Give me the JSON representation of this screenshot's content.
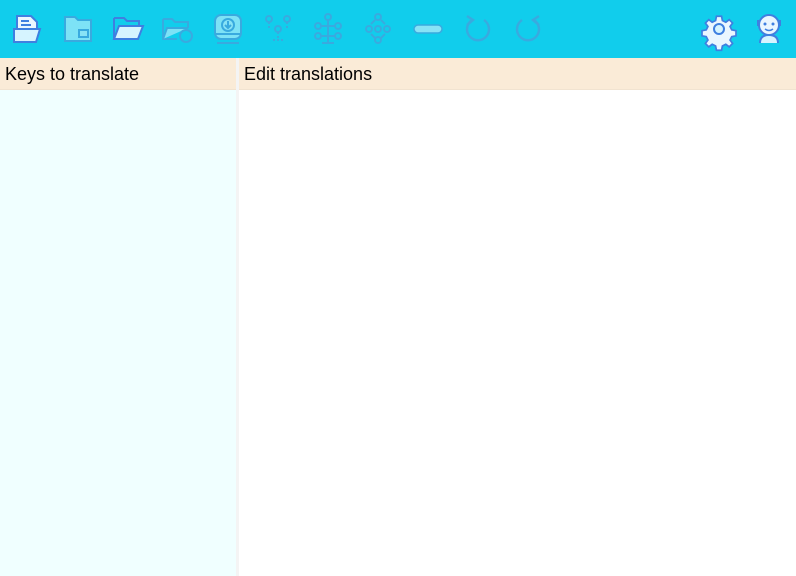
{
  "toolbar": {
    "background": "#11cdec",
    "icon_color": "#d6f4ff",
    "icon_stroke": "#5b8fd6",
    "buttons": [
      {
        "icon": "new-project-icon",
        "state": "enabled"
      },
      {
        "icon": "save-project-icon",
        "state": "disabled"
      },
      {
        "icon": "open-project-icon",
        "state": "enabled"
      },
      {
        "icon": "reload-project-icon",
        "state": "disabled"
      },
      {
        "icon": "export-icon",
        "state": "disabled"
      },
      {
        "icon": "add-key-icon",
        "state": "disabled"
      },
      {
        "icon": "add-node-icon",
        "state": "disabled"
      },
      {
        "icon": "add-language-icon",
        "state": "disabled"
      },
      {
        "icon": "remove-icon",
        "state": "disabled"
      },
      {
        "icon": "undo-icon",
        "state": "disabled"
      },
      {
        "icon": "redo-icon",
        "state": "disabled"
      },
      {
        "icon": "settings-icon",
        "state": "enabled"
      },
      {
        "icon": "about-icon",
        "state": "enabled"
      }
    ]
  },
  "left_panel": {
    "header": "Keys to translate",
    "background": "#f0ffff",
    "header_background": "#faebd7"
  },
  "right_panel": {
    "header": "Edit translations",
    "background": "#ffffff"
  }
}
